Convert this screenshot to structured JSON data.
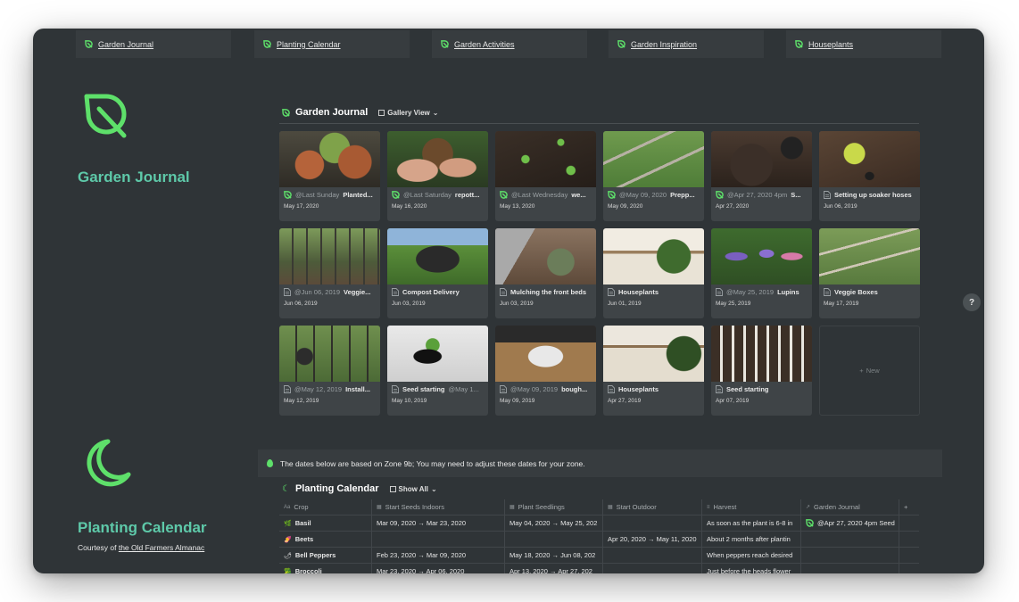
{
  "top_nav": [
    {
      "label": "Garden Journal",
      "icon": "leaf-icon"
    },
    {
      "label": "Planting Calendar",
      "icon": "leaf-icon"
    },
    {
      "label": "Garden Activities",
      "icon": "leaf-icon"
    },
    {
      "label": "Garden Inspiration",
      "icon": "leaf-icon"
    },
    {
      "label": "Houseplants",
      "icon": "leaf-icon"
    }
  ],
  "garden_journal": {
    "section_title": "Garden Journal",
    "db_title": "Garden Journal",
    "view_label": "Gallery View",
    "new_label": "New",
    "cards": [
      {
        "mention": "@Last Sunday",
        "title": "Planted...",
        "date": "May 17, 2020",
        "icon": "leaf-icon",
        "photo": "pots-plants"
      },
      {
        "mention": "@Last Saturday",
        "title": "repott...",
        "date": "May 16, 2020",
        "icon": "leaf-icon",
        "photo": "hands-roots"
      },
      {
        "mention": "@Last Wednesday",
        "title": "we...",
        "date": "May 13, 2020",
        "icon": "leaf-icon",
        "photo": "soil-seedlings"
      },
      {
        "mention": "@May 09, 2020",
        "title": "Prepp...",
        "date": "May 09, 2020",
        "icon": "leaf-icon",
        "photo": "raised-bed"
      },
      {
        "mention": "@Apr 27, 2020 4pm",
        "title": "S...",
        "date": "Apr 27, 2020",
        "icon": "leaf-icon",
        "photo": "dark-soil"
      },
      {
        "mention": "",
        "title": "Setting up soaker hoses",
        "date": "Jun 06, 2019",
        "icon": "page-icon",
        "photo": "soaker-hose"
      },
      {
        "mention": "@Jun 06, 2019",
        "title": "Veggie...",
        "date": "Jun 06, 2019",
        "icon": "page-icon",
        "photo": "garden-fence"
      },
      {
        "mention": "",
        "title": "Compost Delivery",
        "date": "Jun 03, 2019",
        "icon": "page-icon",
        "photo": "truck"
      },
      {
        "mention": "",
        "title": "Mulching the front beds",
        "date": "Jun 03, 2019",
        "icon": "page-icon",
        "photo": "mulch"
      },
      {
        "mention": "",
        "title": "Houseplants",
        "date": "Jun 01, 2019",
        "icon": "page-icon",
        "photo": "shelf-plants"
      },
      {
        "mention": "@May 25, 2019",
        "title": "Lupins",
        "date": "May 25, 2019",
        "icon": "page-icon",
        "photo": "lupins"
      },
      {
        "mention": "",
        "title": "Veggie Boxes",
        "date": "May 17, 2019",
        "icon": "page-icon",
        "photo": "veggie-boxes"
      },
      {
        "mention": "@May 12, 2019",
        "title": "Install...",
        "date": "May 12, 2019",
        "icon": "page-icon",
        "photo": "garden-person"
      },
      {
        "mention": "",
        "title": "Seed starting",
        "title2": "@May 1...",
        "date": "May 10, 2019",
        "icon": "page-icon",
        "photo": "seed-tray"
      },
      {
        "mention": "@May 09, 2019",
        "title": "bough...",
        "date": "May 09, 2019",
        "icon": "page-icon",
        "photo": "bag-soil"
      },
      {
        "mention": "",
        "title": "Houseplants",
        "date": "Apr 27, 2019",
        "icon": "page-icon",
        "photo": "shelf-plants2"
      },
      {
        "mention": "",
        "title": "Seed starting",
        "date": "Apr 07, 2019",
        "icon": "page-icon",
        "photo": "seed-labels"
      }
    ]
  },
  "planting_calendar": {
    "section_title": "Planting Calendar",
    "courtesy_prefix": "Courtesy of",
    "courtesy_link": "the Old Farmers Almanac",
    "callout": "The dates below are based on Zone 9b; You may need to adjust these dates for your zone.",
    "db_title": "Planting Calendar",
    "view_label": "Show All",
    "columns": [
      "Crop",
      "Start Seeds Indoors",
      "Plant Seedlings",
      "Start Outdoor",
      "Harvest",
      "Garden Journal",
      "+"
    ],
    "rows": [
      {
        "crop": "Basil",
        "emoji": "🌿",
        "seeds": "Mar 09, 2020 → Mar 23, 2020",
        "seedlings": "May 04, 2020 → May 25, 202",
        "outdoor": "",
        "harvest": "As soon as the plant is 6-8 in",
        "journal": "@Apr 27, 2020 4pm Seed"
      },
      {
        "crop": "Beets",
        "emoji": "🍠",
        "seeds": "",
        "seedlings": "",
        "outdoor": "Apr 20, 2020 → May 11, 2020",
        "harvest": "About 2 months after plantin",
        "journal": ""
      },
      {
        "crop": "Bell Peppers",
        "emoji": "🌶",
        "seeds": "Feb 23, 2020 → Mar 09, 2020",
        "seedlings": "May 18, 2020 → Jun 08, 202",
        "outdoor": "",
        "harvest": "When peppers reach desired",
        "journal": ""
      },
      {
        "crop": "Broccoli",
        "emoji": "🥦",
        "seeds": "Mar 23, 2020 → Apr 06, 2020",
        "seedlings": "Apr 13, 2020 → Apr 27, 202",
        "outdoor": "",
        "harvest": "Just before the heads flower",
        "journal": ""
      }
    ]
  },
  "help_label": "?",
  "colors": {
    "background": "#2f3437",
    "accent_green": "#5ee06a",
    "title_teal": "#5ec9a9",
    "card": "#3f4447"
  }
}
